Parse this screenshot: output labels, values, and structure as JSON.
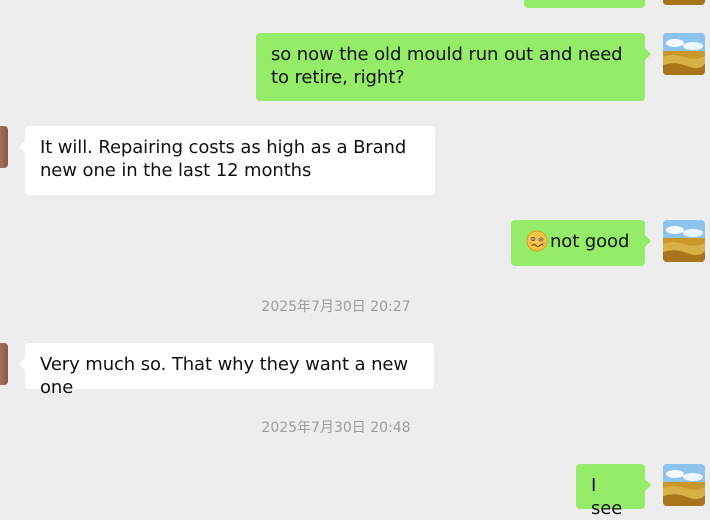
{
  "chat": {
    "messages": [
      {
        "sender": "me",
        "text": "so now the old mould run out and need to retire, right?"
      },
      {
        "sender": "them",
        "text": "It will. Repairing costs as high as a Brand new one in the last 12 months"
      },
      {
        "sender": "me",
        "emoji": "woozy-face-emoji",
        "text": "not good"
      },
      {
        "sender": "them",
        "text": "Very much so. That why they want a new one"
      },
      {
        "sender": "me",
        "text": "I see"
      }
    ],
    "timestamps": [
      "2025年7月30日 20:27",
      "2025年7月30日 20:48"
    ]
  },
  "colors": {
    "background": "#ededed",
    "outgoing_bubble": "#95ec69",
    "incoming_bubble": "#ffffff",
    "timestamp_text": "#9c9c9c"
  },
  "icons": {
    "my_avatar": "wheat-field-avatar",
    "their_avatar": "contact-avatar"
  }
}
